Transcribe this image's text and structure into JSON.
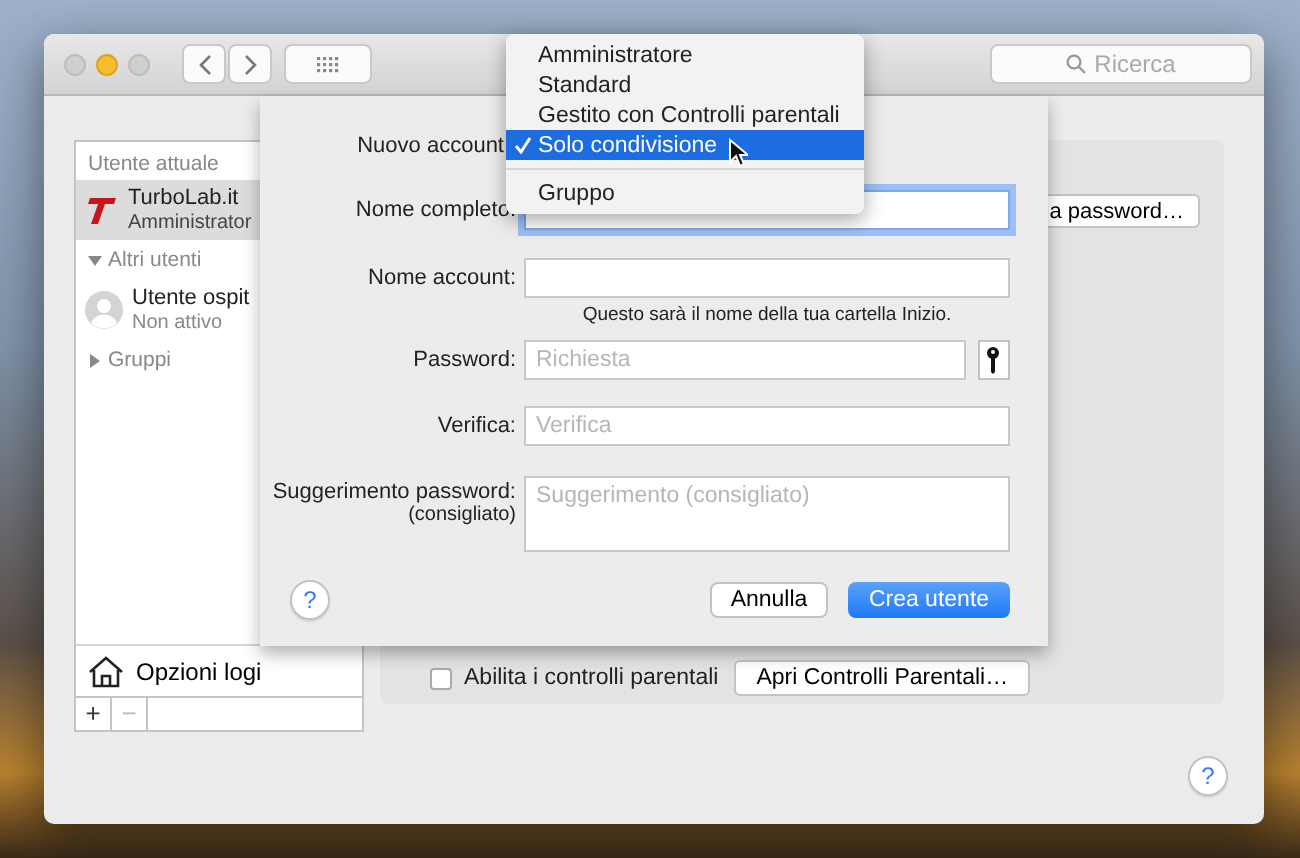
{
  "toolbar": {
    "search": {
      "placeholder": "Ricerca"
    }
  },
  "sidebar": {
    "items": [
      {
        "kind": "header",
        "label": "Utente attuale"
      },
      {
        "kind": "user",
        "name": "TurboLab.it",
        "role": "Amministrator",
        "avatar": {
          "kind": "logo"
        },
        "selected": true
      },
      {
        "kind": "group",
        "label": "Altri utenti",
        "expanded": true,
        "children": [
          {
            "kind": "user",
            "name": "Utente ospit",
            "role": "Non attivo",
            "avatar": {
              "kind": "silhouette"
            },
            "selected": false
          }
        ]
      },
      {
        "kind": "group",
        "label": "Gruppi",
        "expanded": false
      }
    ],
    "login_options": "Opzioni logi",
    "add_button": {
      "label": "+",
      "disabled": false
    },
    "remove_button": {
      "label": "−",
      "disabled": true
    }
  },
  "main": {
    "change_password_button": "a password…",
    "parental_checkbox": {
      "label": "Abilita i controlli parentali",
      "checked": false
    },
    "parental_button": "Apri Controlli Parentali…",
    "help_button": "?"
  },
  "sheet": {
    "account_type_label": "Nuovo account",
    "fields": [
      {
        "kind": "text",
        "label": "Nome completo:",
        "focused": true
      },
      {
        "kind": "text",
        "label": "Nome account:",
        "focused": false,
        "note": "Questo sarà il nome della tua cartella Inizio."
      },
      {
        "kind": "password",
        "label": "Password:",
        "placeholder": "Richiesta",
        "focused": false
      },
      {
        "kind": "text",
        "label": "Verifica:",
        "placeholder": "Verifica",
        "focused": false
      },
      {
        "kind": "multiline",
        "label": "Suggerimento password:",
        "sublabel": "(consigliato)",
        "placeholder": "Suggerimento (consigliato)",
        "focused": false
      }
    ],
    "help_button": "?",
    "cancel_button": "Annulla",
    "create_button": "Crea utente"
  },
  "menu": {
    "items": [
      {
        "kind": "option",
        "label": "Amministratore",
        "selected": false
      },
      {
        "kind": "option",
        "label": "Standard",
        "selected": false
      },
      {
        "kind": "option",
        "label": "Gestito con Controlli parentali",
        "selected": false
      },
      {
        "kind": "option",
        "label": "Solo condivisione",
        "selected": true
      },
      {
        "kind": "separator"
      },
      {
        "kind": "option",
        "label": "Gruppo",
        "selected": false
      }
    ]
  }
}
